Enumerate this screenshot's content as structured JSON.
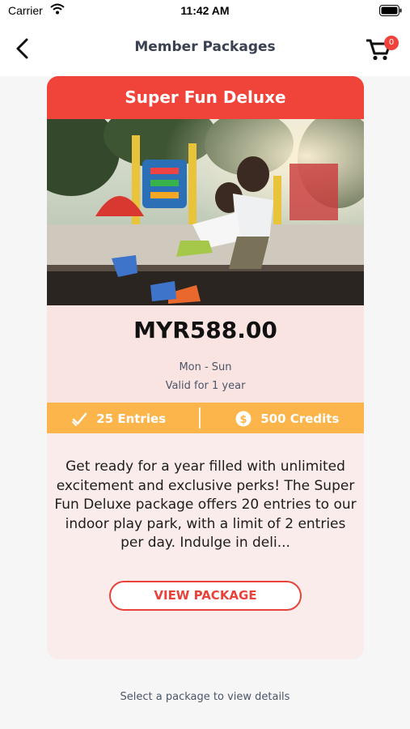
{
  "status_bar": {
    "carrier": "Carrier",
    "time": "11:42 AM"
  },
  "nav": {
    "title": "Member Packages",
    "cart_count": "0"
  },
  "package": {
    "name": "Super Fun Deluxe",
    "price": "MYR588.00",
    "days": "Mon - Sun",
    "validity": "Valid for 1 year",
    "entries": "25 Entries",
    "credits": "500 Credits",
    "description": "Get ready for a year filled with unlimited excitement and exclusive perks! The Super Fun Deluxe package offers 20 entries to our indoor play park, with a limit of 2 entries per day. Indulge in deli...",
    "button_label": "VIEW PACKAGE"
  },
  "footer": {
    "hint": "Select a package to view details"
  },
  "colors": {
    "accent_red": "#f0433a",
    "stats_orange": "#fbb54a",
    "card_bg": "#f9ecea",
    "text_slate": "#4b5668"
  },
  "icons": [
    "wifi-icon",
    "battery-icon",
    "back-arrow-icon",
    "cart-icon",
    "checkmark-icon",
    "dollar-coin-icon"
  ]
}
